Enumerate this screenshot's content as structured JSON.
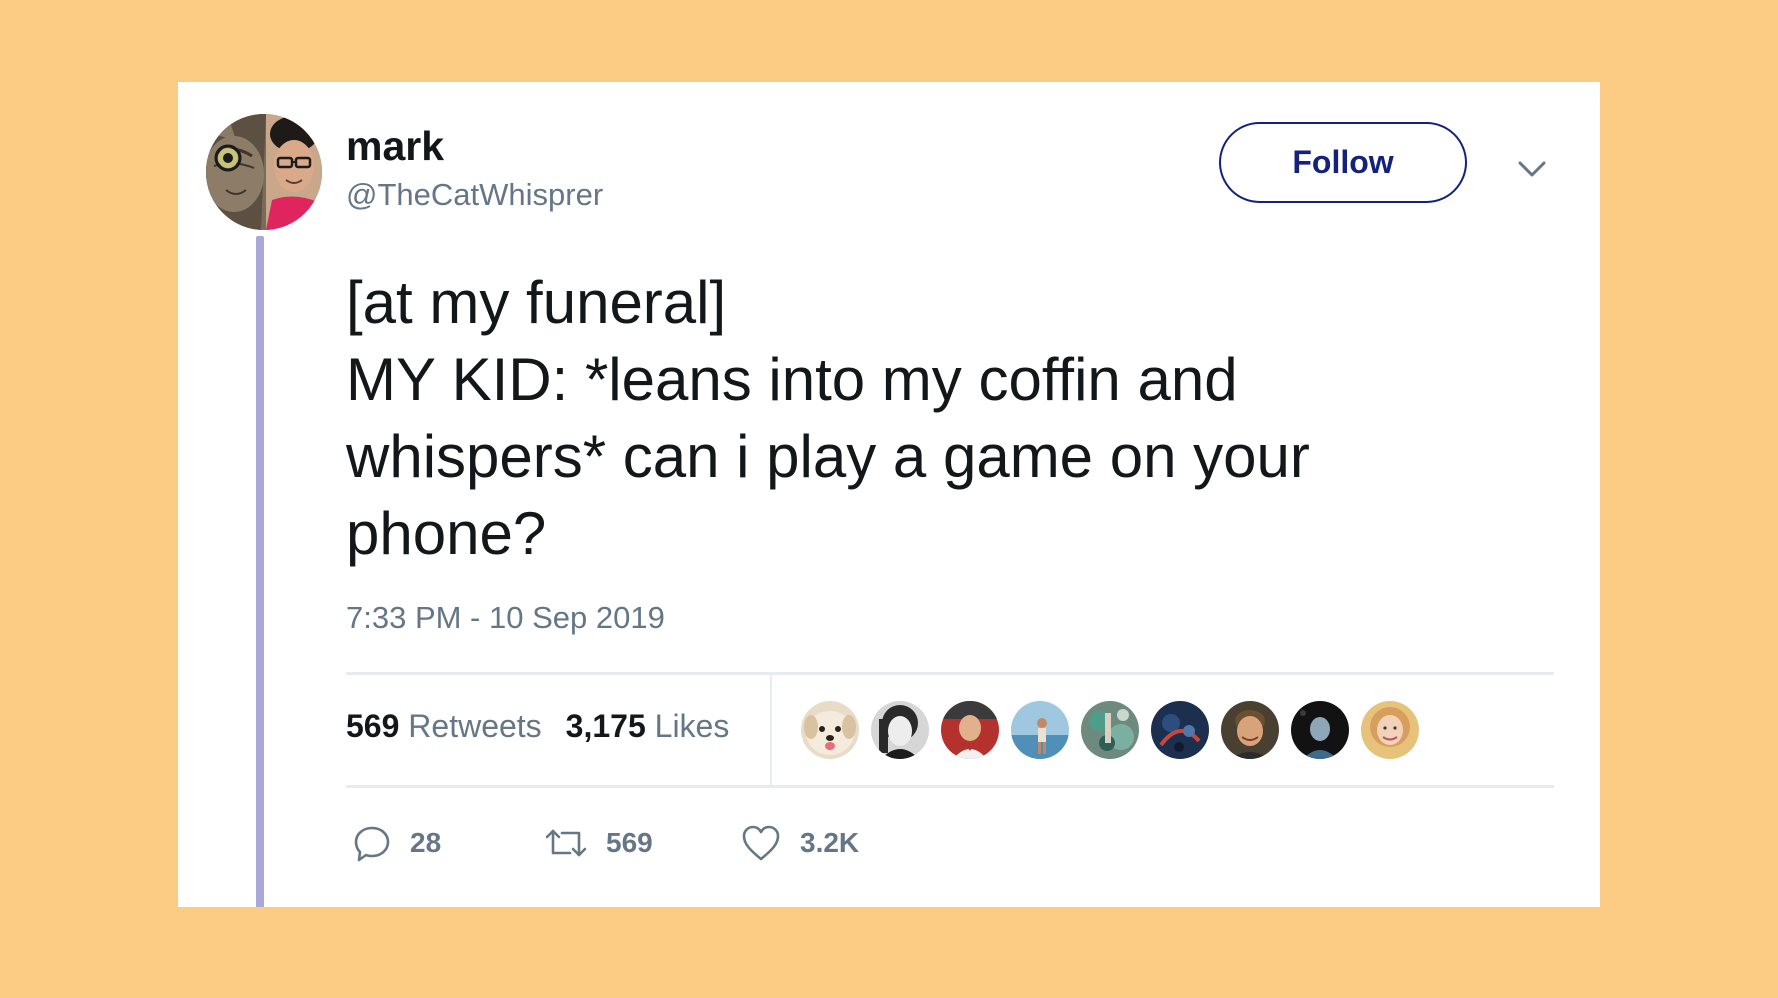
{
  "user": {
    "name": "mark",
    "handle": "@TheCatWhisprer"
  },
  "follow_label": "Follow",
  "tweet": {
    "lines": [
      "[at my funeral]",
      "MY KID: *leans into my coffin and",
      "whispers* can i play a game on your",
      "phone?"
    ],
    "timestamp": "7:33 PM - 10 Sep 2019"
  },
  "stats": {
    "retweets_count": "569",
    "retweets_label": "Retweets",
    "likes_count": "3,175",
    "likes_label": "Likes"
  },
  "actions": {
    "replies": "28",
    "retweets": "569",
    "likes": "3.2K"
  },
  "icons": {
    "menu": "chevron-down-icon",
    "reply": "reply-icon",
    "retweet": "retweet-icon",
    "like": "heart-icon"
  },
  "colors": {
    "background": "#FCCB84",
    "card": "#FFFFFF",
    "follow_accent": "#14227E",
    "thread_line": "#A9A9D9",
    "secondary_text": "#657786"
  }
}
